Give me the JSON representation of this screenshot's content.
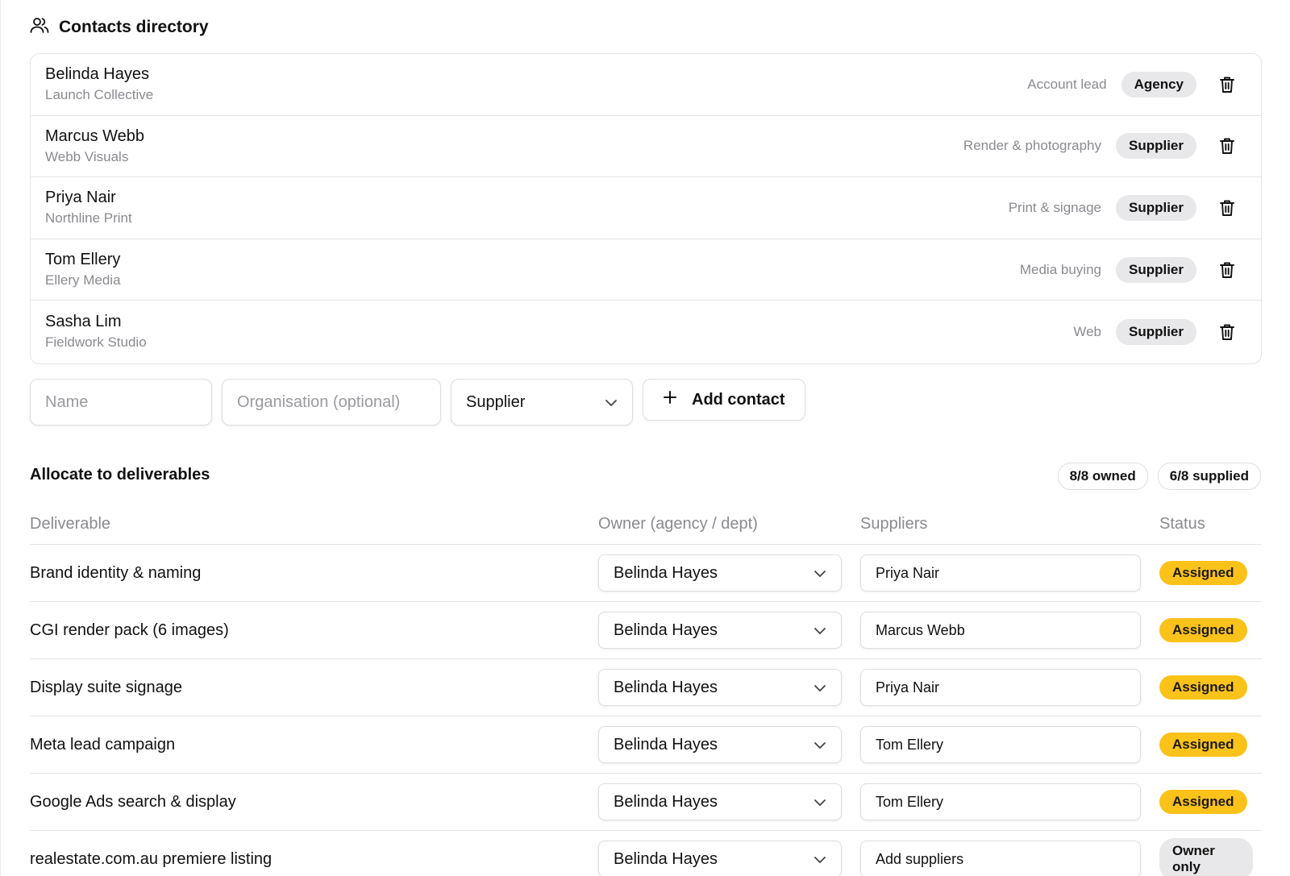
{
  "contacts_section": {
    "title": "Contacts directory",
    "icon": "users-icon"
  },
  "contacts": [
    {
      "name": "Belinda Hayes",
      "organisation": "Launch Collective",
      "role": "Account lead",
      "type": "Agency"
    },
    {
      "name": "Marcus Webb",
      "organisation": "Webb Visuals",
      "role": "Render & photography",
      "type": "Supplier"
    },
    {
      "name": "Priya Nair",
      "organisation": "Northline Print",
      "role": "Print & signage",
      "type": "Supplier"
    },
    {
      "name": "Tom Ellery",
      "organisation": "Ellery Media",
      "role": "Media buying",
      "type": "Supplier"
    },
    {
      "name": "Sasha Lim",
      "organisation": "Fieldwork Studio",
      "role": "Web",
      "type": "Supplier"
    }
  ],
  "add_form": {
    "name_placeholder": "Name",
    "organisation_placeholder": "Organisation (optional)",
    "type_value": "Supplier",
    "add_label": "Add contact"
  },
  "allocation": {
    "title": "Allocate to deliverables",
    "owned_badge": "8/8 owned",
    "supplied_badge": "6/8 supplied",
    "columns": {
      "deliverable": "Deliverable",
      "owner": "Owner (agency / dept)",
      "suppliers": "Suppliers",
      "status": "Status"
    },
    "rows": [
      {
        "deliverable": "Brand identity & naming",
        "owner": "Belinda Hayes",
        "suppliers": "Priya Nair",
        "status": "Assigned"
      },
      {
        "deliverable": "CGI render pack (6 images)",
        "owner": "Belinda Hayes",
        "suppliers": "Marcus Webb",
        "status": "Assigned"
      },
      {
        "deliverable": "Display suite signage",
        "owner": "Belinda Hayes",
        "suppliers": "Priya Nair",
        "status": "Assigned"
      },
      {
        "deliverable": "Meta lead campaign",
        "owner": "Belinda Hayes",
        "suppliers": "Tom Ellery",
        "status": "Assigned"
      },
      {
        "deliverable": "Google Ads search & display",
        "owner": "Belinda Hayes",
        "suppliers": "Tom Ellery",
        "status": "Assigned"
      },
      {
        "deliverable": "realestate.com.au premiere listing",
        "owner": "Belinda Hayes",
        "suppliers": "Add suppliers",
        "status": "Owner only"
      }
    ]
  },
  "colors": {
    "accent_assigned": "#fbc21a",
    "pill_grey": "#e8e8ea",
    "muted_text": "#8a8a90",
    "border": "#e4e4e7"
  }
}
